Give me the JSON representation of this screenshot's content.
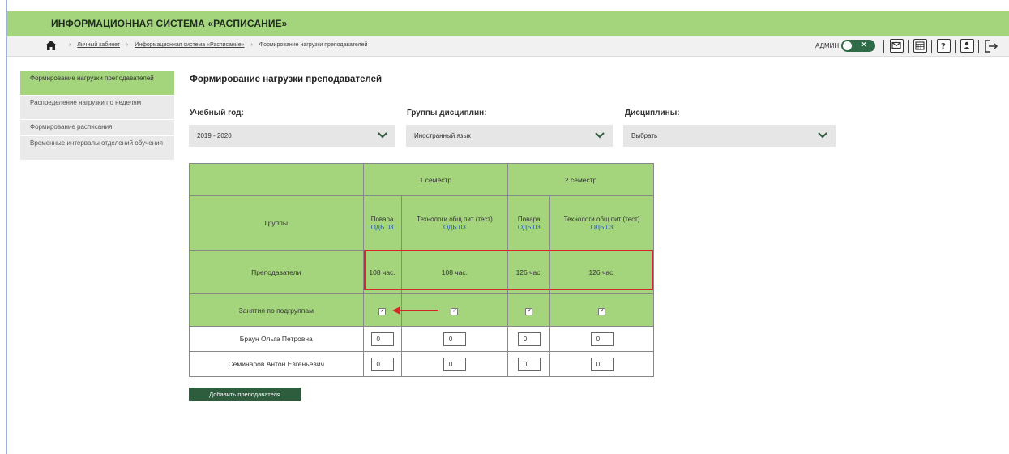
{
  "header": {
    "title": "ИНФОРМАЦИОННАЯ СИСТЕМА «РАСПИСАНИЕ»",
    "home_icon": "home-icon",
    "breadcrumbs": [
      "Личный кабинет",
      "Информационная система «Расписание»",
      "Формирование нагрузки преподавателей"
    ],
    "user_label": "АДМИН",
    "toggle_label": "×",
    "toolbar_icons": [
      "mail-icon",
      "calendar-icon",
      "help-icon",
      "profile-icon",
      "logout-icon"
    ]
  },
  "sidebar": {
    "items": [
      {
        "label": "Формирование нагрузки преподавателей",
        "active": true
      },
      {
        "label": "Распределение нагрузки по неделям",
        "active": false
      },
      {
        "label": "Формирование расписания",
        "active": false
      },
      {
        "label": "Временные интервалы отделений обучения",
        "active": false
      }
    ]
  },
  "page": {
    "title": "Формирование нагрузки преподавателей"
  },
  "filters": {
    "year": {
      "label": "Учебный год:",
      "value": "2019 - 2020"
    },
    "group": {
      "label": "Группы дисциплин:",
      "value": "Иностранный язык"
    },
    "discipline": {
      "label": "Дисциплины:",
      "value": "Выбрать"
    }
  },
  "table": {
    "semesters": [
      "1 семестр",
      "2 семестр"
    ],
    "row_labels": {
      "groups": "Группы",
      "teachers": "Преподаватели",
      "subgroups": "Занятия по подгруппам"
    },
    "columns": [
      {
        "group": "Повара",
        "code": "ОДБ.03",
        "hours": "108 час."
      },
      {
        "group": "Технологи общ пит (тест)",
        "code": "ОДБ.03",
        "hours": "108 час."
      },
      {
        "group": "Повара",
        "code": "ОДБ.03",
        "hours": "126 час."
      },
      {
        "group": "Технологи общ пит (тест)",
        "code": "ОДБ.03",
        "hours": "126 час."
      }
    ],
    "check_mark": "✔",
    "teachers": [
      {
        "name": "Браун Ольга Петровна",
        "values": [
          "0",
          "0",
          "0",
          "0"
        ]
      },
      {
        "name": "Семинаров Антон Евгеньевич",
        "values": [
          "0",
          "0",
          "0",
          "0"
        ]
      }
    ]
  },
  "actions": {
    "add_teacher": "Добавить преподавателя"
  },
  "colors": {
    "header_green": "#a4d57c",
    "button_green": "#2d5d3d",
    "highlight_red": "#d62828",
    "link_blue": "#2a58b5"
  }
}
